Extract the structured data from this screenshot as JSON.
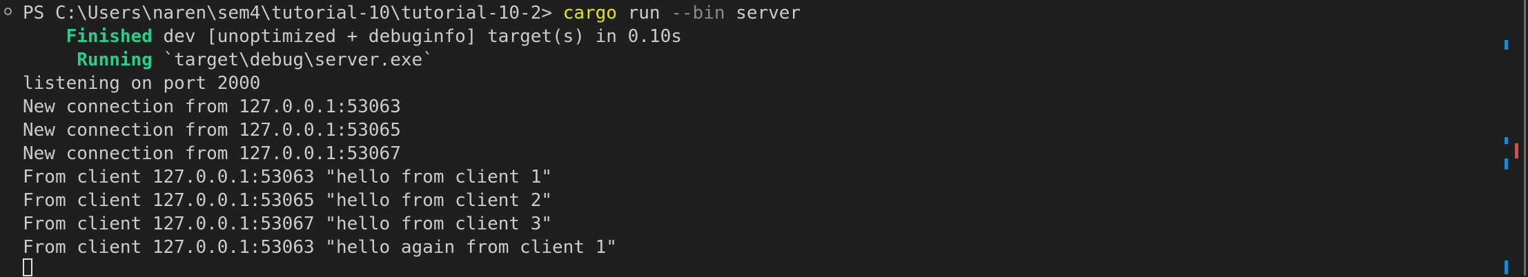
{
  "terminal": {
    "prompt": "PS C:\\Users\\naren\\sem4\\tutorial-10\\tutorial-10-2> ",
    "command": "cargo",
    "command_args_1": " run ",
    "command_flag": "--bin",
    "command_args_2": " server",
    "finished_label": "Finished",
    "finished_text": " dev [unoptimized + debuginfo] target(s) in 0.10s",
    "running_label": "Running",
    "running_text": " `target\\debug\\server.exe`",
    "output_lines": [
      "listening on port 2000",
      "New connection from 127.0.0.1:53063",
      "New connection from 127.0.0.1:53065",
      "New connection from 127.0.0.1:53067",
      "From client 127.0.0.1:53063 \"hello from client 1\"",
      "From client 127.0.0.1:53065 \"hello from client 2\"",
      "From client 127.0.0.1:53067 \"hello from client 3\"",
      "From client 127.0.0.1:53063 \"hello again from client 1\""
    ]
  },
  "colors": {
    "background": "#1f1f1f",
    "text": "#cccccc",
    "command": "#e5e510",
    "flag": "#8a8a8a",
    "cargo_status": "#23d18b",
    "scroll_marker_blue": "#1e8ad6",
    "scroll_marker_red": "#e04848"
  }
}
